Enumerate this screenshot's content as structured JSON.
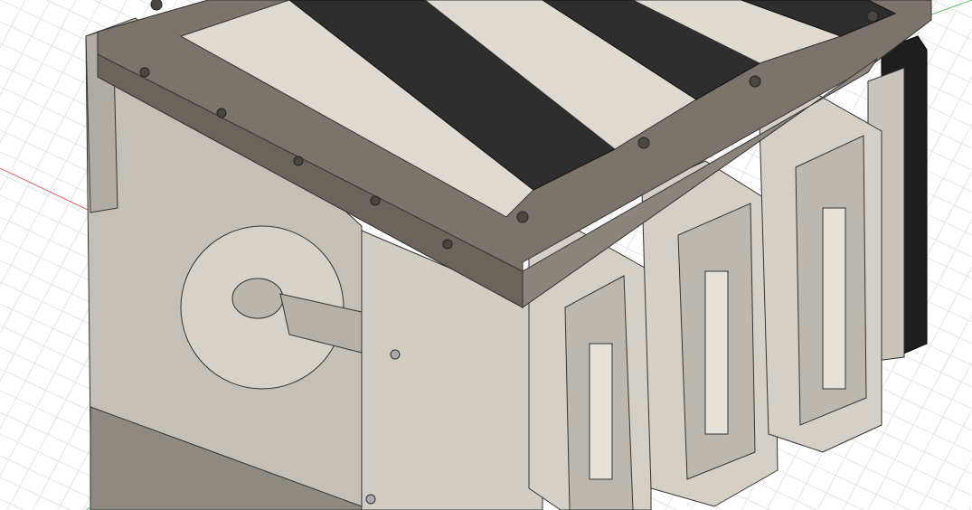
{
  "viewport": {
    "background": "#ffffff",
    "grid_color": "#e2e4e6",
    "x_axis_color": "#e06060",
    "y_axis_color": "#60c060",
    "frame_color": "#7a746c",
    "panel_color": "#cdc9c1",
    "panel_dark": "#a7a39b",
    "slot_light": "#dedad2",
    "slot_dark": "#2e2e2e",
    "edge_color": "#333333"
  }
}
